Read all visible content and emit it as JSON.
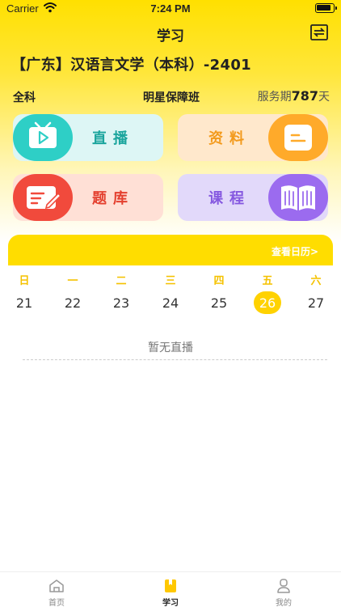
{
  "status": {
    "carrier": "Carrier",
    "time": "7:24 PM"
  },
  "nav": {
    "title": "学习",
    "switch_icon": "switch-icon"
  },
  "course": {
    "title": "【广东】汉语言文学（本科）-2401"
  },
  "info": {
    "subject": "全科",
    "class_name": "明星保障班",
    "service_prefix": "服务期",
    "service_days": "787",
    "service_suffix": "天"
  },
  "tiles": {
    "live": {
      "label": "直播",
      "icon": "tv-play-icon"
    },
    "materials": {
      "label": "资料",
      "icon": "document-icon"
    },
    "question_bank": {
      "label": "题库",
      "icon": "edit-note-icon"
    },
    "courses": {
      "label": "课程",
      "icon": "book-icon"
    }
  },
  "calendar": {
    "link": "查看日历>",
    "weekdays": [
      "日",
      "一",
      "二",
      "三",
      "四",
      "五",
      "六"
    ],
    "days": [
      "21",
      "22",
      "23",
      "24",
      "25",
      "26",
      "27"
    ],
    "selected_day": "26"
  },
  "live_empty": "暂无直播",
  "tabbar": [
    {
      "label": "首页",
      "icon": "home-icon"
    },
    {
      "label": "学习",
      "icon": "bookmark-book-icon"
    },
    {
      "label": "我的",
      "icon": "user-icon"
    }
  ],
  "colors": {
    "brand_yellow": "#FFDD00",
    "live": "#2ECFC6",
    "materials": "#FFAA2A",
    "question_bank": "#F14A3C",
    "courses": "#9B6BEF"
  }
}
